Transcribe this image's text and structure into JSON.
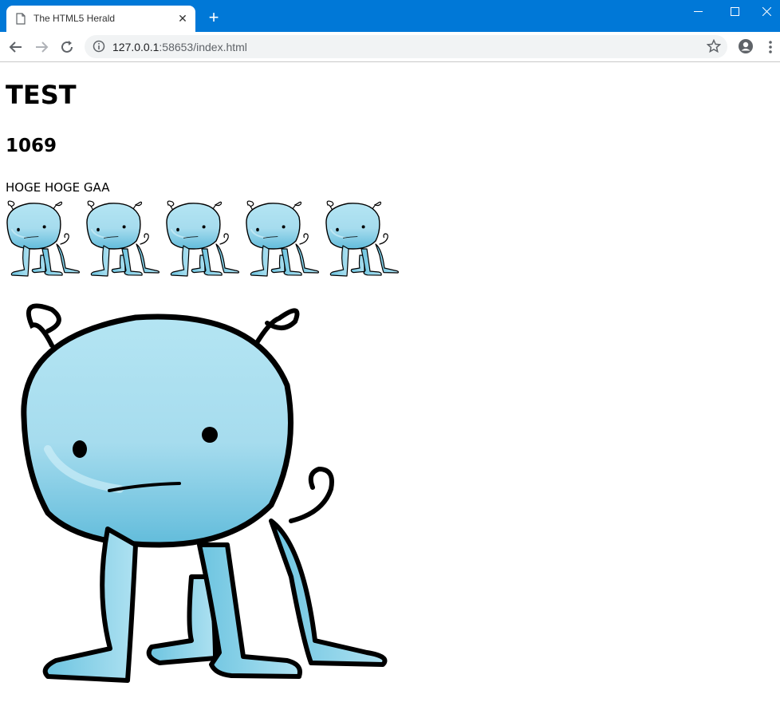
{
  "browser": {
    "tab_title": "The HTML5 Herald",
    "url_host": "127.0.0.1",
    "url_rest": ":58653/index.html"
  },
  "page": {
    "heading": "TEST",
    "subheading": "1069",
    "paragraph": "HOGE HOGE GAA"
  },
  "images": {
    "creature_name": "blue-creature",
    "thumbnail_count": 5
  },
  "colors": {
    "titlebar": "#0078d7",
    "creature_body": "#a8dff0"
  }
}
